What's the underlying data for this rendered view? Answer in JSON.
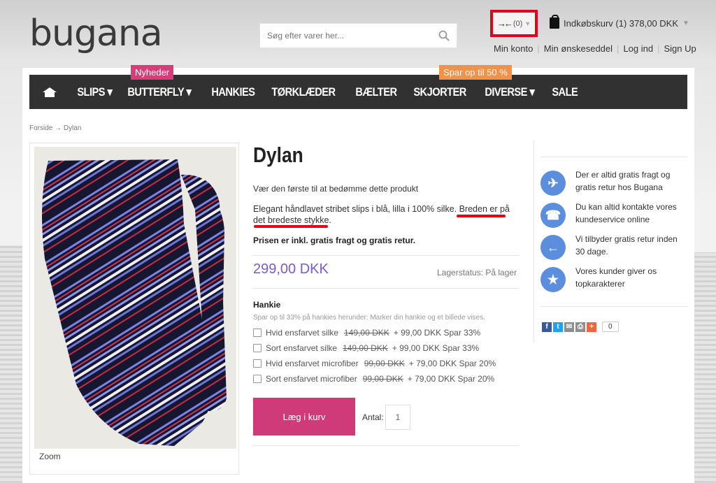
{
  "header": {
    "logo": "bugana",
    "search_placeholder": "Søg efter varer her...",
    "compare_label": "(0)",
    "cart_label": "Indkøbskurv (1)  378,00 DKK",
    "user_links": [
      "Min konto",
      "Min ønskeseddel",
      "Log ind",
      "Sign Up"
    ]
  },
  "nav": {
    "items": [
      "SLIPS",
      "BUTTERFLY",
      "HANKIES",
      "TØRKLÆDER",
      "BÆLTER",
      "SKJORTER",
      "DIVERSE",
      "SALE"
    ],
    "badge_nyheder": "Nyheder",
    "badge_spar": "Spar op til 50 %"
  },
  "breadcrumb": "Forside → Dylan",
  "product": {
    "zoom": "Zoom",
    "title": "Dylan",
    "rate_prompt": "Vær den første til at bedømme dette produkt",
    "description": "Elegant håndlavet stribet slips i blå, lilla i 100% silke. Breden er på det bredeste stykke.",
    "free_shipping": "Prisen er inkl. gratis fragt og gratis retur.",
    "price": "299,00 DKK",
    "stock": "Lagerstatus: På lager",
    "add_to_cart": "Læg i kurv",
    "qty_label": "Antal:",
    "qty_value": "1"
  },
  "hankie": {
    "title": "Hankie",
    "hint": "Spar op til 33% på hankies herunder: Marker din hankie og et billede vises.",
    "options": [
      {
        "name": "Hvid ensfarvet silke",
        "old": "149,00 DKK",
        "new": "+ 99,00 DKK",
        "save": "Spar 33%"
      },
      {
        "name": "Sort ensfarvet silke",
        "old": "149,00 DKK",
        "new": "+ 99,00 DKK",
        "save": "Spar 33%"
      },
      {
        "name": "Hvid ensfarvet microfiber",
        "old": "99,00 DKK",
        "new": "+ 79,00 DKK",
        "save": "Spar 20%"
      },
      {
        "name": "Sort ensfarvet microfiber",
        "old": "99,00 DKK",
        "new": "+ 79,00 DKK",
        "save": "Spar 20%"
      }
    ]
  },
  "perks": [
    {
      "icon": "airplane-icon",
      "text": "Der er altid gratis fragt og gratis retur hos Bugana"
    },
    {
      "icon": "phone-icon",
      "text": "Du kan altid kontakte vores kundeservice online"
    },
    {
      "icon": "arrow-left-icon",
      "text": "Vi tilbyder gratis retur inden 30 dage."
    },
    {
      "icon": "star-icon",
      "text": "Vores kunder giver os topkarakterer"
    }
  ],
  "share": {
    "count": "0"
  },
  "colors": {
    "nav_bg": "#313131",
    "accent_pink": "#cf3a78",
    "price_purple": "#7a5bd0",
    "badge_orange": "#f2914a",
    "perk_blue": "#5b8fde",
    "highlight_red": "#e3001b"
  }
}
